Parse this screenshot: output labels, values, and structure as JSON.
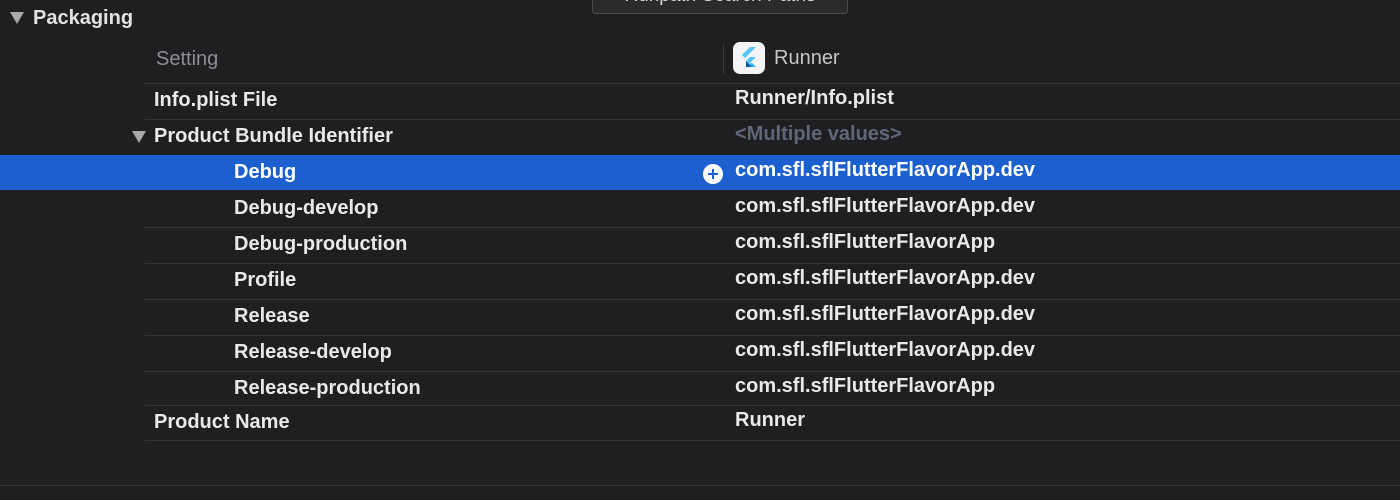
{
  "tooltip": "Runpath Search Paths",
  "section": {
    "title": "Packaging"
  },
  "columns": {
    "setting": "Setting",
    "target": "Runner"
  },
  "rows": [
    {
      "name": "Info.plist File",
      "value": "Runner/Info.plist"
    },
    {
      "name": "Product Bundle Identifier",
      "value": "<Multiple values>"
    },
    {
      "name": "Debug",
      "value": "com.sfl.sflFlutterFlavorApp.dev"
    },
    {
      "name": "Debug-develop",
      "value": "com.sfl.sflFlutterFlavorApp.dev"
    },
    {
      "name": "Debug-production",
      "value": "com.sfl.sflFlutterFlavorApp"
    },
    {
      "name": "Profile",
      "value": "com.sfl.sflFlutterFlavorApp.dev"
    },
    {
      "name": "Release",
      "value": "com.sfl.sflFlutterFlavorApp.dev"
    },
    {
      "name": "Release-develop",
      "value": "com.sfl.sflFlutterFlavorApp.dev"
    },
    {
      "name": "Release-production",
      "value": "com.sfl.sflFlutterFlavorApp"
    },
    {
      "name": "Product Name",
      "value": "Runner"
    }
  ],
  "colors": {
    "background": "#1f1f21",
    "selection": "#1c5fce",
    "muted_value": "#5f6678"
  },
  "icons": {
    "disclosure": "disclosure-triangle-icon",
    "target": "flutter-app-icon",
    "add": "plus-circle-icon"
  }
}
